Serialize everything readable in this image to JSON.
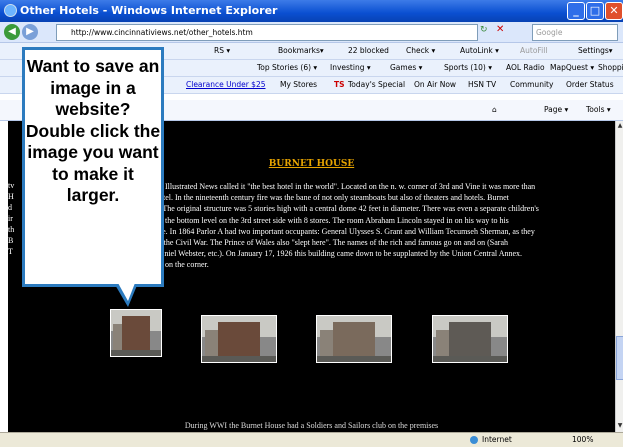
{
  "window": {
    "title": "Other Hotels - Windows Internet Explorer",
    "minimize_icon": "minimize-icon",
    "maximize_icon": "maximize-icon",
    "close_icon": "close-icon"
  },
  "address_bar": {
    "url": "http://www.cincinnativiews.net/other_hotels.htm",
    "search_placeholder": "Google"
  },
  "toolbar1": {
    "items": [
      "Bookmarks▾",
      "22 blocked",
      "Check ▾",
      "AutoLink ▾",
      "AutoFill",
      "Settings▾"
    ]
  },
  "toolbar2": {
    "items": [
      "Top Stories (6) ▾",
      "Investing ▾",
      "Games ▾",
      "Sports (10) ▾",
      "AOL Radio",
      "MapQuest ▾",
      "Shoppi"
    ],
    "rs_label": "RS ▾"
  },
  "toolbar3": {
    "items": [
      "Clearance Under $25",
      "My Stores",
      "TS",
      "Today's Special",
      "On Air Now",
      "HSN TV",
      "Community",
      "Order Status"
    ]
  },
  "tabrow": {
    "page_menu": "Page ▾",
    "tools_menu": "Tools ▾"
  },
  "content": {
    "heading": "BURNET HOUSE",
    "lines": [
      "on Illustrated News called it \"the best hotel in the world\". Located on the n. w. corner of 3rd and Vine it was more than",
      "hotel. In the nineteenth century fire was the bane of not only steamboats but also of theaters and hotels. Burnet",
      "e. The original structure was 5 stories high with a central dome 42 feet in diameter. There was even a separate children's",
      "on the bottom level on the 3rd street side with 8 stores. The room Abraham Lincoln stayed in on his way to his",
      "ace. In 1864 Parlor A had two important occupants: General Ulysses S. Grant and William Tecumseh Sherman, as they",
      "of the Civil War. The Prince of Wales also \"slept here\". The names of the rich and famous go on and on (Sarah",
      "Daniel Webster, etc.). On January 17, 1926 this building came down to be supplanted by the Union Central Annex.",
      "tel on the corner."
    ],
    "left_edge_letters": [
      "tv",
      "H",
      "d",
      "ir",
      "th",
      "B",
      "T"
    ],
    "bottom_text": "During WWI the Burnet House had a Soldiers and Sailors club on the premises"
  },
  "callout": {
    "text": "Want to save an image in a website? Double click the image you want to make it larger."
  },
  "status": {
    "zone": "Internet",
    "zoom": "100%"
  }
}
